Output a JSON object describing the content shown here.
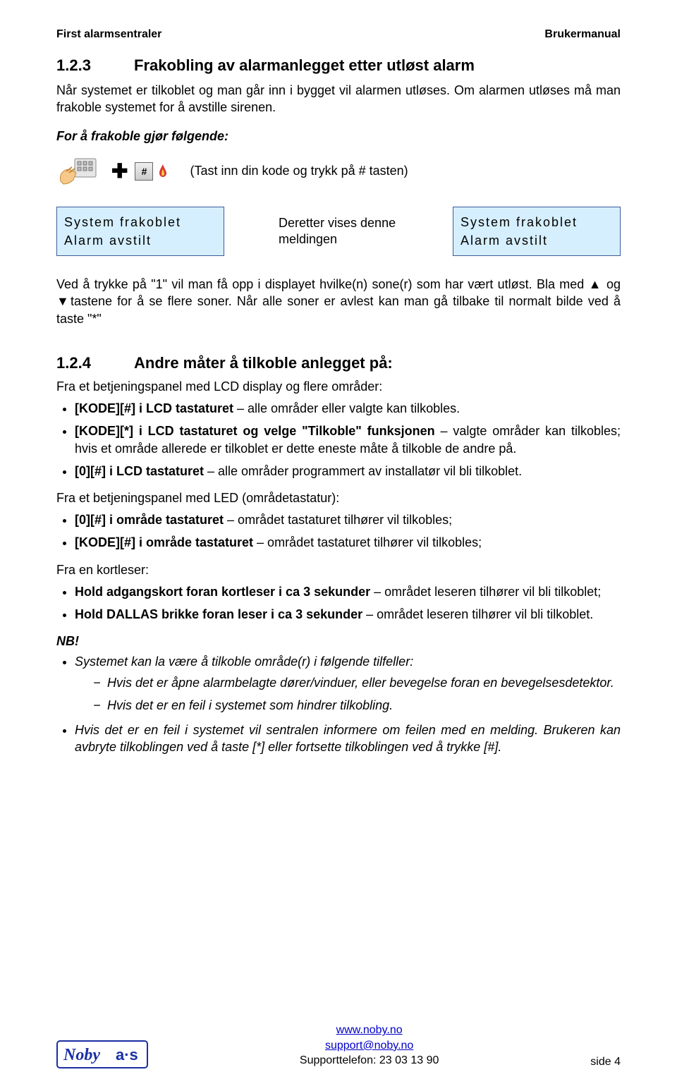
{
  "header": {
    "left": "First alarmsentraler",
    "right": "Brukermanual"
  },
  "section123": {
    "number": "1.2.3",
    "title": "Frakobling av alarmanlegget etter utløst alarm",
    "intro": "Når systemet er tilkoblet og man går inn i bygget vil alarmen utløses. Om alarmen utløses må man frakoble systemet for å avstille sirenen.",
    "lead": "For å frakoble gjør følgende:",
    "instruction": "(Tast inn din kode og trykk på # tasten)",
    "lcd1_line1": "System frakoblet",
    "lcd1_line2": "Alarm avstilt",
    "mid": "Deretter vises denne meldingen",
    "lcd2_line1": "System frakoblet",
    "lcd2_line2": "Alarm avstilt",
    "after": "Ved å trykke på \"1\" vil man få opp i displayet hvilke(n) sone(r) som har vært utløst. Bla med ▲ og ▼tastene for å se flere soner. Når alle soner er avlest kan man gå tilbake til normalt bilde ved å taste \"*\""
  },
  "section124": {
    "number": "1.2.4",
    "title": "Andre måter å tilkoble anlegget på:",
    "sub1": "Fra et betjeningspanel med LCD display og flere områder:",
    "bullets1": [
      {
        "bold": "[KODE][#] i LCD tastaturet",
        "rest": " – alle områder eller valgte kan tilkobles."
      },
      {
        "bold": "[KODE][*] i LCD tastaturet og velge \"Tilkoble\" funksjonen",
        "rest": " – valgte områder kan tilkobles; hvis et område allerede er tilkoblet er dette eneste måte å tilkoble de andre på."
      },
      {
        "bold": "[0][#] i LCD tastaturet",
        "rest": " – alle områder programmert av installatør vil bli tilkoblet."
      }
    ],
    "sub2": "Fra et betjeningspanel med LED (områdetastatur):",
    "bullets2": [
      {
        "bold": "[0][#] i område tastaturet",
        "rest": " – området tastaturet tilhører vil tilkobles;"
      },
      {
        "bold": "[KODE][#] i område tastaturet",
        "rest": " – området tastaturet tilhører vil tilkobles;"
      }
    ],
    "sub3": "Fra en kortleser:",
    "bullets3": [
      {
        "bold": "Hold adgangskort foran kortleser i ca 3 sekunder",
        "rest": " – området leseren tilhører vil bli tilkoblet;"
      },
      {
        "bold": "Hold DALLAS brikke foran leser i ca 3 sekunder",
        "rest": " – området leseren tilhører vil bli tilkoblet."
      }
    ],
    "nb_label": "NB!",
    "nb_bullets": [
      {
        "lead": "Systemet kan la være å tilkoble område(r) i følgende tilfeller:",
        "dashes": [
          "Hvis det er åpne alarmbelagte dører/vinduer, eller bevegelse foran en bevegelsesdetektor.",
          "Hvis det er en feil i systemet som hindrer tilkobling."
        ]
      },
      {
        "lead": "Hvis det er en feil i systemet vil sentralen informere om feilen med en melding. Brukeren kan avbryte tilkoblingen ved å taste [*] eller fortsette tilkoblingen ved å trykke [#]."
      }
    ]
  },
  "footer": {
    "url": "www.noby.no",
    "email": "support@noby.no",
    "phone": "Supporttelefon: 23 03 13 90",
    "page": "side 4",
    "logo_main": "Noby",
    "logo_sub": "a·s"
  }
}
